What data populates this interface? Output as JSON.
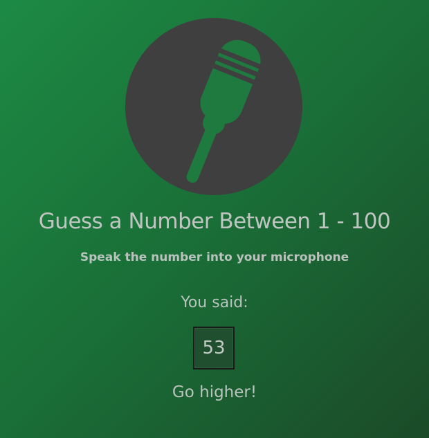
{
  "app": {
    "title": "Guess a Number Between 1 - 100",
    "subtitle": "Speak the number into your microphone"
  },
  "result": {
    "label": "You said:",
    "spoken_number": "53",
    "feedback": "Go higher!"
  },
  "icons": {
    "mic": "microphone-icon"
  },
  "colors": {
    "background_start": "#1c8a44",
    "background_end": "#1b4a28",
    "circle": "#3f3f3f",
    "icon": "#1f7a3f",
    "text": "#b9c3bd"
  }
}
